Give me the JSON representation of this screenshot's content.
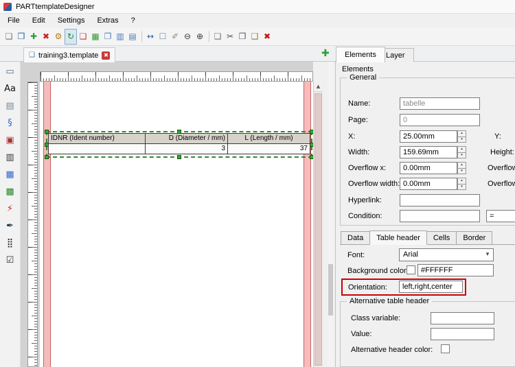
{
  "window": {
    "title": "PARTtemplateDesigner"
  },
  "menu": {
    "items": [
      {
        "label": "File",
        "name": "menu-file"
      },
      {
        "label": "Edit",
        "name": "menu-edit"
      },
      {
        "label": "Settings",
        "name": "menu-settings"
      },
      {
        "label": "Extras",
        "name": "menu-extras"
      },
      {
        "label": "?",
        "name": "menu-help"
      }
    ]
  },
  "toolbar": {
    "items": [
      {
        "name": "new-template-button",
        "icon": "new-document-icon",
        "glyph": "❏",
        "color": "#707070"
      },
      {
        "name": "save-button",
        "icon": "save-icon",
        "glyph": "❒",
        "color": "#2a5caa"
      },
      {
        "name": "add-button",
        "icon": "plus-icon",
        "glyph": "✚",
        "color": "#2e9e2e"
      },
      {
        "name": "remove-button",
        "icon": "cross-icon",
        "glyph": "✖",
        "color": "#cc2222"
      },
      {
        "name": "settings-button",
        "icon": "gear-icon",
        "glyph": "⚙",
        "color": "#c07818"
      },
      {
        "name": "refresh-preview-button",
        "icon": "refresh-icon",
        "glyph": "↻",
        "color": "#1f8f1f",
        "cls": "selected"
      },
      {
        "name": "export-pdf-button",
        "icon": "pdf-page-icon",
        "glyph": "❏",
        "color": "#cc3333"
      },
      {
        "name": "insert-image-button",
        "icon": "image-icon",
        "glyph": "▦",
        "color": "#2e9e2e"
      },
      {
        "name": "duplicate-button",
        "icon": "copy-pages-icon",
        "glyph": "❐",
        "color": "#4a7ab5"
      },
      {
        "name": "layout-columns-button",
        "icon": "columns-icon",
        "glyph": "▥",
        "color": "#4a7ab5"
      },
      {
        "name": "layout-rows-button",
        "icon": "rows-icon",
        "glyph": "▤",
        "color": "#4a7ab5"
      },
      {
        "name": "toolbar-separator",
        "glyph": "",
        "cls": "sep",
        "noninteractable": true
      },
      {
        "name": "fit-width-button",
        "icon": "horizontal-arrow-icon",
        "glyph": "↔",
        "color": "#2a5caa"
      },
      {
        "name": "selection-frame-button",
        "icon": "dashed-box-icon",
        "glyph": "☐",
        "color": "#6a8ab5"
      },
      {
        "name": "draw-button",
        "icon": "pencil-icon",
        "glyph": "✐",
        "color": "#8a8a8a"
      },
      {
        "name": "zoom-out-button",
        "icon": "zoom-out-icon",
        "glyph": "⊖",
        "color": "#3a3a3a"
      },
      {
        "name": "zoom-in-button",
        "icon": "zoom-in-icon",
        "glyph": "⊕",
        "color": "#3a3a3a"
      },
      {
        "name": "toolbar-separator",
        "glyph": "",
        "cls": "sep",
        "noninteractable": true
      },
      {
        "name": "preview-page-button",
        "icon": "page-icon",
        "glyph": "❏",
        "color": "#707070"
      },
      {
        "name": "cut-button",
        "icon": "scissors-icon",
        "glyph": "✂",
        "color": "#555555"
      },
      {
        "name": "copy-button",
        "icon": "copy-icon",
        "glyph": "❐",
        "color": "#555555"
      },
      {
        "name": "paste-button",
        "icon": "clipboard-icon",
        "glyph": "❑",
        "color": "#a07030"
      },
      {
        "name": "delete-element-button",
        "icon": "delete-icon",
        "glyph": "✖",
        "color": "#d01010"
      }
    ]
  },
  "left_toolbar": {
    "items": [
      {
        "name": "rectangle-tool-button",
        "icon": "rectangle-icon",
        "glyph": "▭",
        "color": "#556688"
      },
      {
        "name": "text-tool-button",
        "icon": "text-icon",
        "glyph": "Aa",
        "color": "#111111"
      },
      {
        "name": "field-tool-button",
        "icon": "field-icon",
        "glyph": "▤",
        "color": "#778899"
      },
      {
        "name": "curve-tool-button",
        "icon": "curve-icon",
        "glyph": "§",
        "color": "#3366cc"
      },
      {
        "name": "stamp-tool-button",
        "icon": "stamp-icon",
        "glyph": "▣",
        "color": "#aa3333"
      },
      {
        "name": "list-tool-button",
        "icon": "list-icon",
        "glyph": "▥",
        "color": "#333333"
      },
      {
        "name": "table-tool-button",
        "icon": "table-icon",
        "glyph": "▦",
        "color": "#3366cc"
      },
      {
        "name": "image-tool-button",
        "icon": "picture-icon",
        "glyph": "▩",
        "color": "#2a8a2a"
      },
      {
        "name": "action-tool-button",
        "icon": "lightning-icon",
        "glyph": "⚡",
        "color": "#d02020"
      },
      {
        "name": "pin-tool-button",
        "icon": "pin-icon",
        "glyph": "✒",
        "color": "#223344"
      },
      {
        "name": "datamatrix-tool-button",
        "icon": "qrcode-icon",
        "glyph": "⣿",
        "color": "#111111"
      },
      {
        "name": "checkbox-tool-button",
        "icon": "checkbox-icon",
        "glyph": "☑",
        "color": "#333333"
      }
    ]
  },
  "tabrow": {
    "document_tab": "training3.template"
  },
  "icons": {
    "close": "✖",
    "add_tab": "✚",
    "template": "❏",
    "dropdown": "▾",
    "scroll_up": "▲",
    "spin_up": "▴",
    "spin_down": "▾"
  },
  "canvas": {
    "table": {
      "columns": [
        {
          "header": "IDNR (Ident number)",
          "value": ""
        },
        {
          "header": "D (Diameter / mm)",
          "value": "3"
        },
        {
          "header": "L (Length / mm)",
          "value": "37"
        }
      ]
    }
  },
  "panel": {
    "tabs": {
      "elements": "Elements",
      "layer": "Layer"
    },
    "title": "Elements",
    "general": {
      "legend": "General",
      "name_label": "Name:",
      "name_value": "tabelle",
      "page_label": "Page:",
      "page_value": "0",
      "x_label": "X:",
      "x_value": "25.00mm",
      "y_label": "Y:",
      "width_label": "Width:",
      "width_value": "159.69mm",
      "height_label": "Height:",
      "overflow_x_label": "Overflow x:",
      "overflow_x_value": "0.00mm",
      "overflow_y_label": "Overflow y",
      "overflow_width_label": "Overflow width:",
      "overflow_width_value": "0.00mm",
      "overflow_h_label": "Overflow h",
      "hyperlink_label": "Hyperlink:",
      "condition_label": "Condition:",
      "condition_operator": "="
    },
    "subtabs": {
      "items": [
        {
          "label": "Data",
          "name": "subtab-data"
        },
        {
          "label": "Table header",
          "name": "subtab-table-header",
          "cls": "active"
        },
        {
          "label": "Cells",
          "name": "subtab-cells"
        },
        {
          "label": "Border",
          "name": "subtab-border"
        }
      ]
    },
    "table_header": {
      "font_label": "Font:",
      "font_value": "Arial",
      "background_color_label": "Background color:",
      "background_color_value": "#FFFFFF",
      "orientation_label": "Orientation:",
      "orientation_value": "left,right,center",
      "alternative": {
        "legend": "Alternative table header",
        "class_variable_label": "Class variable:",
        "value_label": "Value:",
        "alternative_header_color_label": "Alternative header color:"
      }
    }
  },
  "colors": {
    "highlight_red": "#cc0000",
    "selection_green": "#2e8b2e",
    "margin_pink": "#f4bcbc",
    "table_header_gray": "#d6d3cb",
    "background_swatch": "#FFFFFF"
  }
}
